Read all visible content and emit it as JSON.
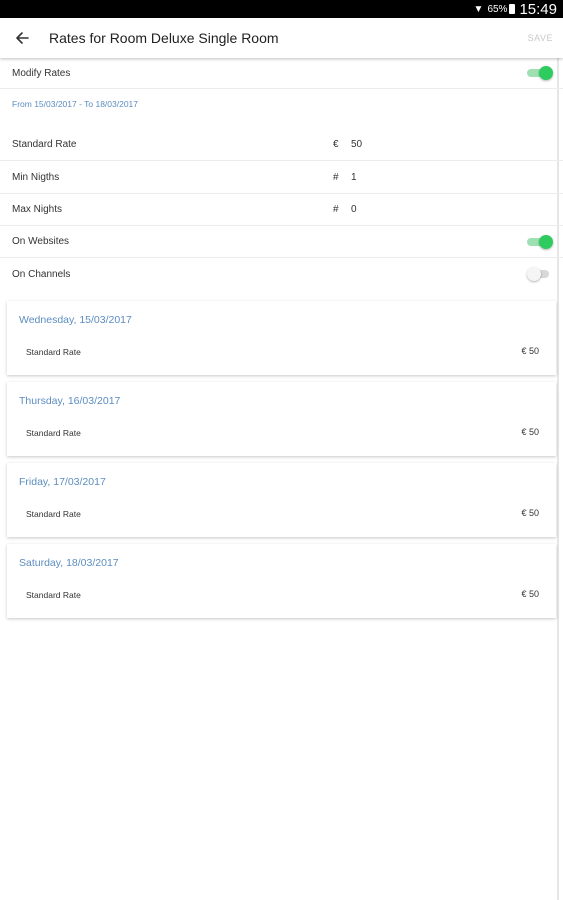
{
  "status_bar": {
    "battery": "65%",
    "time": "15:49"
  },
  "app_bar": {
    "title": "Rates for Room Deluxe Single Room",
    "save_label": "SAVE"
  },
  "modify_rates": {
    "label": "Modify Rates",
    "enabled": true
  },
  "date_range": "From 15/03/2017 - To 18/03/2017",
  "fields": {
    "standard_rate": {
      "label": "Standard Rate",
      "prefix": "€",
      "value": "50"
    },
    "min_nights": {
      "label": "Min Nigths",
      "prefix": "#",
      "value": "1"
    },
    "max_nights": {
      "label": "Max Nights",
      "prefix": "#",
      "value": "0"
    }
  },
  "on_websites": {
    "label": "On Websites",
    "enabled": true
  },
  "on_channels": {
    "label": "On Channels",
    "enabled": false
  },
  "days": [
    {
      "date": "Wednesday, 15/03/2017",
      "rate_label": "Standard Rate",
      "rate_value": "€ 50"
    },
    {
      "date": "Thursday, 16/03/2017",
      "rate_label": "Standard Rate",
      "rate_value": "€ 50"
    },
    {
      "date": "Friday, 17/03/2017",
      "rate_label": "Standard Rate",
      "rate_value": "€ 50"
    },
    {
      "date": "Saturday, 18/03/2017",
      "rate_label": "Standard Rate",
      "rate_value": "€ 50"
    }
  ],
  "colors": {
    "accent_blue": "#5b8dc0",
    "toggle_on": "#2ecc5e",
    "toggle_off": "#d8d8d8"
  }
}
